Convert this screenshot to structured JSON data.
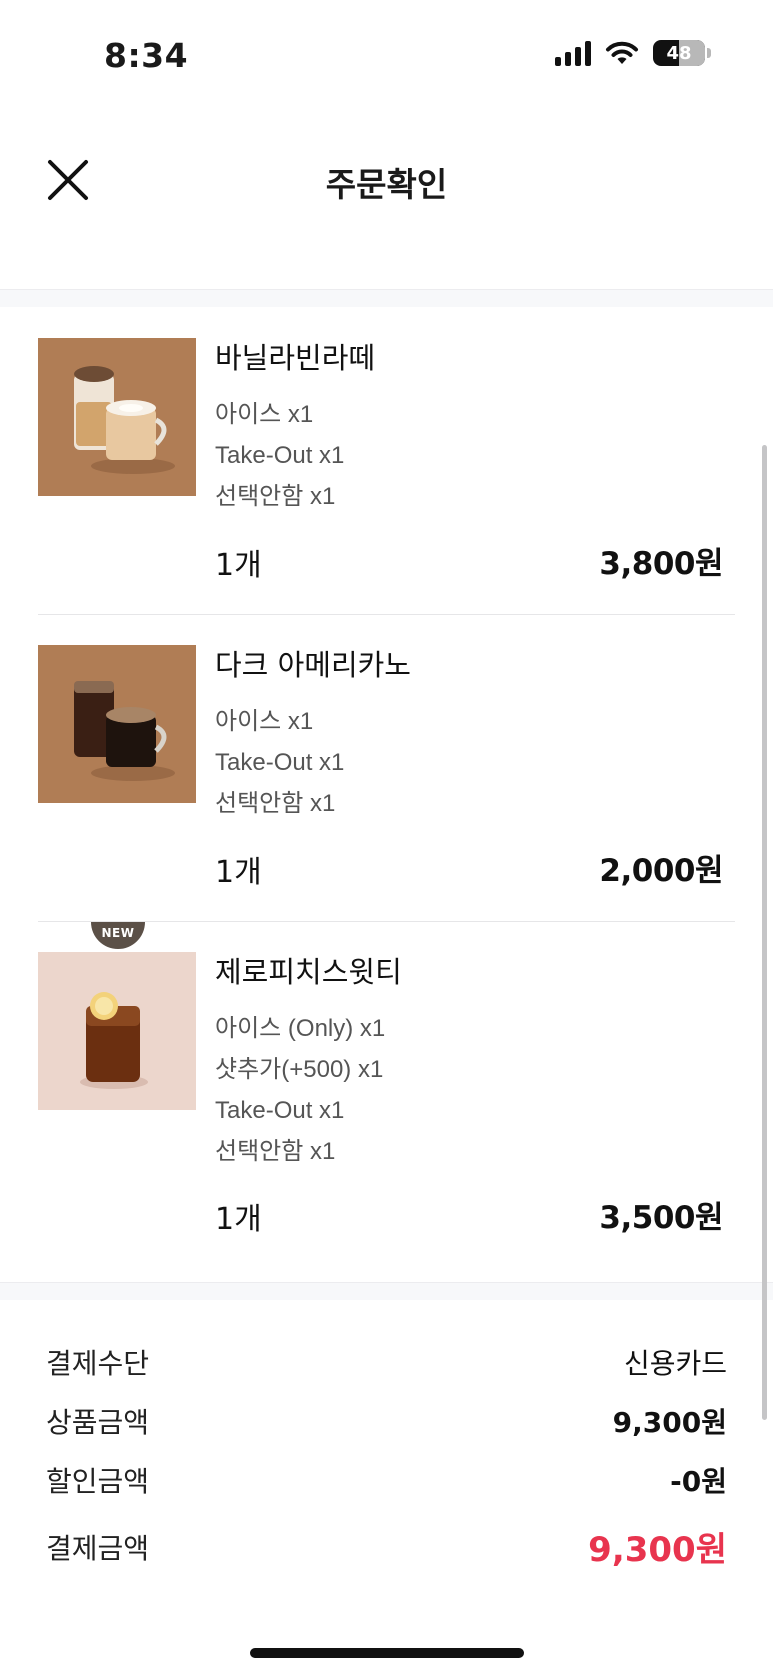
{
  "status_bar": {
    "time": "8:34",
    "battery": "48",
    "icons": [
      "cellular-signal-icon",
      "wifi-icon",
      "battery-icon"
    ]
  },
  "header": {
    "title": "주문확인",
    "close_icon": "close-icon"
  },
  "order_items": [
    {
      "name": "바닐라빈라떼",
      "options": [
        "아이스 x1",
        "Take-Out x1",
        "선택안함 x1"
      ],
      "quantity": "1개",
      "price": "3,800원",
      "badge": ""
    },
    {
      "name": "다크 아메리카노",
      "options": [
        "아이스 x1",
        "Take-Out x1",
        "선택안함 x1"
      ],
      "quantity": "1개",
      "price": "2,000원",
      "badge": ""
    },
    {
      "name": "제로피치스윗티",
      "options": [
        "아이스 (Only) x1",
        "샷추가(+500) x1",
        "Take-Out x1",
        "선택안함 x1"
      ],
      "quantity": "1개",
      "price": "3,500원",
      "badge": "NEW"
    }
  ],
  "summary": {
    "payment_method_label": "결제수단",
    "payment_method_value": "신용카드",
    "product_amount_label": "상품금액",
    "product_amount_value": "9,300원",
    "discount_label": "할인금액",
    "discount_value": "-0원",
    "total_label": "결제금액",
    "total_value": "9,300원"
  },
  "colors": {
    "accent_total": "#e8344e",
    "section_background": "#f7f8fa",
    "badge_background": "#5b5047"
  }
}
